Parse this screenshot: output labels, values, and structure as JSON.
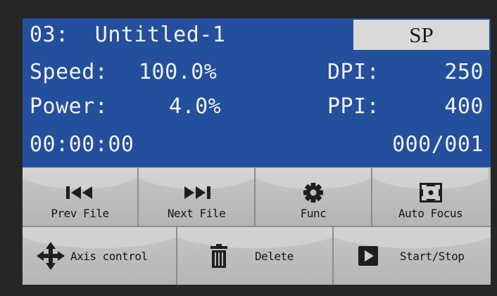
{
  "status": {
    "file_line": "03:  Untitled-1",
    "mode_badge": "SP",
    "speed_label": "Speed:",
    "speed_value": "100.0%",
    "power_label": "Power:",
    "power_value": "4.0%",
    "dpi_label": "DPI:",
    "dpi_value": "250",
    "ppi_label": "PPI:",
    "ppi_value": "400",
    "elapsed": "00:00:00",
    "counter": "000/001"
  },
  "buttons_row1": [
    {
      "label": "Prev File",
      "icon": "skip-back-icon"
    },
    {
      "label": "Next File",
      "icon": "skip-forward-icon"
    },
    {
      "label": "Func",
      "icon": "gear-icon"
    },
    {
      "label": "Auto Focus",
      "icon": "focus-target-icon"
    }
  ],
  "buttons_row2": [
    {
      "label": "Axis control",
      "icon": "move-arrows-icon"
    },
    {
      "label": "Delete",
      "icon": "trash-icon"
    },
    {
      "label": "Start/Stop",
      "icon": "play-icon"
    }
  ],
  "colors": {
    "panel_blue": "#234f9c",
    "text_light": "#f1f1f1",
    "button_gray": "#bdbdbd",
    "icon_dark": "#1e1e1e"
  }
}
